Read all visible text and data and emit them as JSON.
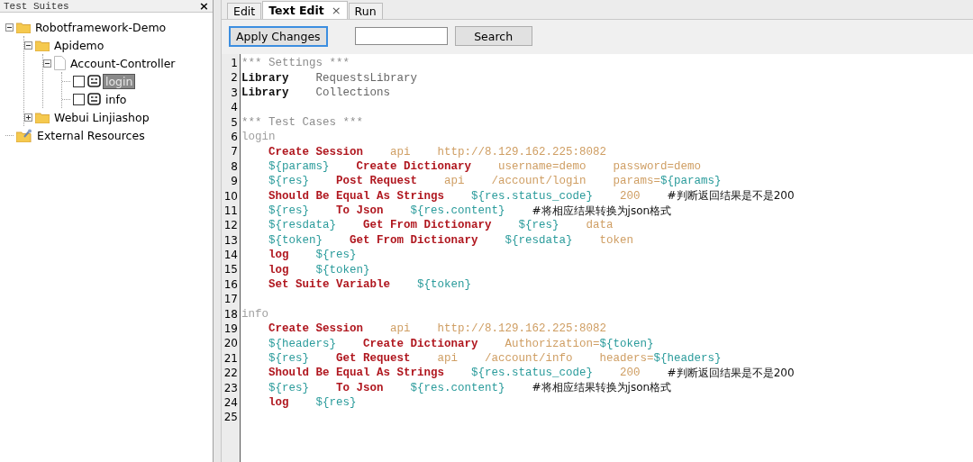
{
  "left_panel": {
    "title": "Test Suites",
    "close": "×"
  },
  "tree": [
    {
      "label": "Robotframework-Demo",
      "kind": "folder",
      "expanded": true,
      "children": [
        {
          "label": "Apidemo",
          "kind": "folder",
          "expanded": true,
          "children": [
            {
              "label": "Account-Controller",
              "kind": "file",
              "expanded": true,
              "children": [
                {
                  "label": "login",
                  "kind": "test",
                  "checked": false,
                  "selected": true
                },
                {
                  "label": "info",
                  "kind": "test",
                  "checked": false,
                  "selected": false
                }
              ]
            }
          ]
        },
        {
          "label": "Webui Linjiashop",
          "kind": "folder",
          "expanded": false
        }
      ]
    },
    {
      "label": "External Resources",
      "kind": "resource"
    }
  ],
  "tabs": [
    {
      "label": "Edit",
      "selected": false
    },
    {
      "label": "Text Edit",
      "selected": true,
      "close": "×"
    },
    {
      "label": "Run",
      "selected": false
    }
  ],
  "toolbar": {
    "apply": "Apply Changes",
    "search_button": "Search"
  },
  "lines": [
    {
      "number": "1",
      "indent": false,
      "cells": [
        [
          {
            "kind": "header",
            "text": "*** Settings ***"
          }
        ]
      ]
    },
    {
      "number": "2",
      "indent": false,
      "cells": [
        [
          {
            "kind": "setting",
            "text": "Library"
          }
        ],
        [
          {
            "kind": "value",
            "text": "RequestsLibrary"
          }
        ]
      ]
    },
    {
      "number": "3",
      "indent": false,
      "cells": [
        [
          {
            "kind": "setting",
            "text": "Library"
          }
        ],
        [
          {
            "kind": "value",
            "text": "Collections"
          }
        ]
      ]
    },
    {
      "number": "4"
    },
    {
      "number": "5",
      "indent": false,
      "cells": [
        [
          {
            "kind": "header",
            "text": "*** Test Cases ***"
          }
        ]
      ]
    },
    {
      "number": "6",
      "indent": false,
      "cells": [
        [
          {
            "kind": "name",
            "text": "login"
          }
        ]
      ]
    },
    {
      "number": "7",
      "indent": true,
      "cells": [
        [
          {
            "kind": "keyword",
            "text": "Create Session"
          }
        ],
        [
          {
            "kind": "arg",
            "text": "api"
          }
        ],
        [
          {
            "kind": "arg",
            "text": "http://8.129.162.225:8082"
          }
        ]
      ]
    },
    {
      "number": "8",
      "indent": true,
      "cells": [
        [
          {
            "kind": "var",
            "text": "${params}"
          }
        ],
        [
          {
            "kind": "keyword",
            "text": "Create Dictionary"
          }
        ],
        [
          {
            "kind": "arg",
            "text": "username=demo"
          }
        ],
        [
          {
            "kind": "arg",
            "text": "password=demo"
          }
        ]
      ]
    },
    {
      "number": "9",
      "indent": true,
      "cells": [
        [
          {
            "kind": "var",
            "text": "${res}"
          }
        ],
        [
          {
            "kind": "keyword",
            "text": "Post Request"
          }
        ],
        [
          {
            "kind": "arg",
            "text": "api"
          }
        ],
        [
          {
            "kind": "arg",
            "text": "/account/login"
          }
        ],
        [
          {
            "kind": "arg",
            "text": "params="
          },
          {
            "kind": "var",
            "text": "${params}"
          }
        ]
      ]
    },
    {
      "number": "10",
      "indent": true,
      "cells": [
        [
          {
            "kind": "keyword",
            "text": "Should Be Equal As Strings"
          }
        ],
        [
          {
            "kind": "var",
            "text": "${res.status_code}"
          }
        ],
        [
          {
            "kind": "arg",
            "text": "200"
          }
        ],
        [
          {
            "kind": "comment",
            "text": "#判断返回结果是不是200"
          }
        ]
      ]
    },
    {
      "number": "11",
      "indent": true,
      "cells": [
        [
          {
            "kind": "var",
            "text": "${res}"
          }
        ],
        [
          {
            "kind": "keyword",
            "text": "To Json"
          }
        ],
        [
          {
            "kind": "var",
            "text": "${res.content}"
          }
        ],
        [
          {
            "kind": "comment",
            "text": "#将相应结果转换为json格式"
          }
        ]
      ]
    },
    {
      "number": "12",
      "indent": true,
      "cells": [
        [
          {
            "kind": "var",
            "text": "${resdata}"
          }
        ],
        [
          {
            "kind": "keyword",
            "text": "Get From Dictionary"
          }
        ],
        [
          {
            "kind": "var",
            "text": "${res}"
          }
        ],
        [
          {
            "kind": "arg",
            "text": "data"
          }
        ]
      ]
    },
    {
      "number": "13",
      "indent": true,
      "cells": [
        [
          {
            "kind": "var",
            "text": "${token}"
          }
        ],
        [
          {
            "kind": "keyword",
            "text": "Get From Dictionary"
          }
        ],
        [
          {
            "kind": "var",
            "text": "${resdata}"
          }
        ],
        [
          {
            "kind": "arg",
            "text": "token"
          }
        ]
      ]
    },
    {
      "number": "14",
      "indent": true,
      "cells": [
        [
          {
            "kind": "keyword",
            "text": "log"
          }
        ],
        [
          {
            "kind": "var",
            "text": "${res}"
          }
        ]
      ]
    },
    {
      "number": "15",
      "indent": true,
      "cells": [
        [
          {
            "kind": "keyword",
            "text": "log"
          }
        ],
        [
          {
            "kind": "var",
            "text": "${token}"
          }
        ]
      ]
    },
    {
      "number": "16",
      "indent": true,
      "cells": [
        [
          {
            "kind": "keyword",
            "text": "Set Suite Variable"
          }
        ],
        [
          {
            "kind": "var",
            "text": "${token}"
          }
        ]
      ]
    },
    {
      "number": "17"
    },
    {
      "number": "18",
      "indent": false,
      "cells": [
        [
          {
            "kind": "name",
            "text": "info"
          }
        ]
      ]
    },
    {
      "number": "19",
      "indent": true,
      "cells": [
        [
          {
            "kind": "keyword",
            "text": "Create Session"
          }
        ],
        [
          {
            "kind": "arg",
            "text": "api"
          }
        ],
        [
          {
            "kind": "arg",
            "text": "http://8.129.162.225:8082"
          }
        ]
      ]
    },
    {
      "number": "20",
      "indent": true,
      "cells": [
        [
          {
            "kind": "var",
            "text": "${headers}"
          }
        ],
        [
          {
            "kind": "keyword",
            "text": "Create Dictionary"
          }
        ],
        [
          {
            "kind": "arg",
            "text": "Authorization="
          },
          {
            "kind": "var",
            "text": "${token}"
          }
        ]
      ]
    },
    {
      "number": "21",
      "indent": true,
      "cells": [
        [
          {
            "kind": "var",
            "text": "${res}"
          }
        ],
        [
          {
            "kind": "keyword",
            "text": "Get Request"
          }
        ],
        [
          {
            "kind": "arg",
            "text": "api"
          }
        ],
        [
          {
            "kind": "arg",
            "text": "/account/info"
          }
        ],
        [
          {
            "kind": "arg",
            "text": "headers="
          },
          {
            "kind": "var",
            "text": "${headers}"
          }
        ]
      ]
    },
    {
      "number": "22",
      "indent": true,
      "cells": [
        [
          {
            "kind": "keyword",
            "text": "Should Be Equal As Strings"
          }
        ],
        [
          {
            "kind": "var",
            "text": "${res.status_code}"
          }
        ],
        [
          {
            "kind": "arg",
            "text": "200"
          }
        ],
        [
          {
            "kind": "comment",
            "text": "#判断返回结果是不是200"
          }
        ]
      ]
    },
    {
      "number": "23",
      "indent": true,
      "cells": [
        [
          {
            "kind": "var",
            "text": "${res}"
          }
        ],
        [
          {
            "kind": "keyword",
            "text": "To Json"
          }
        ],
        [
          {
            "kind": "var",
            "text": "${res.content}"
          }
        ],
        [
          {
            "kind": "comment",
            "text": "#将相应结果转换为json格式"
          }
        ]
      ]
    },
    {
      "number": "24",
      "indent": true,
      "cells": [
        [
          {
            "kind": "keyword",
            "text": "log"
          }
        ],
        [
          {
            "kind": "var",
            "text": "${res}"
          }
        ]
      ]
    },
    {
      "number": "25"
    }
  ]
}
